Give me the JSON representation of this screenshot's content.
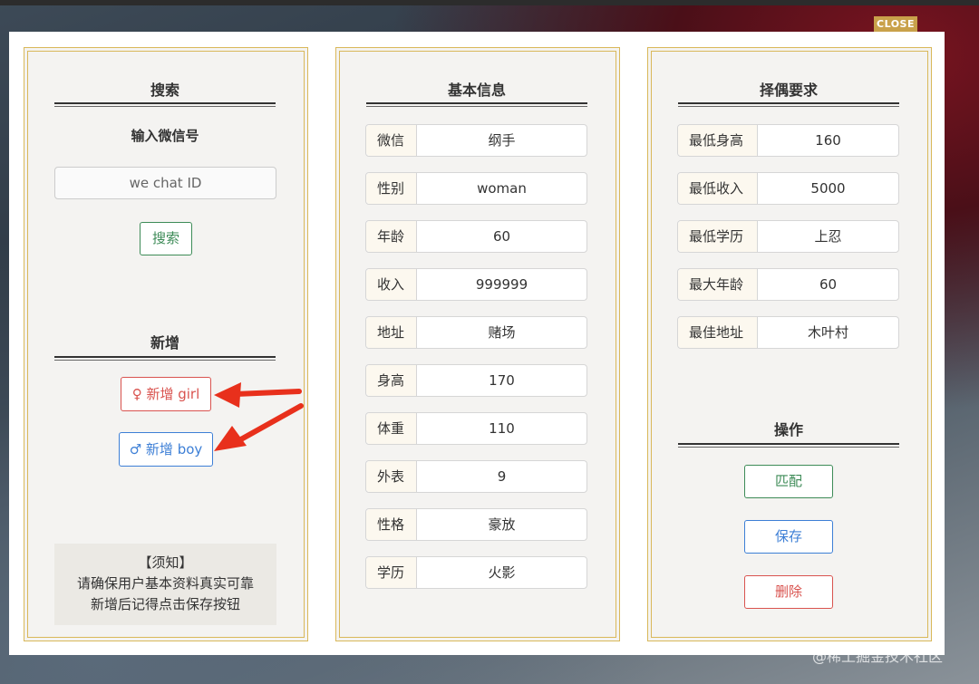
{
  "close_label": "CLOSE",
  "search_panel": {
    "title": "搜索",
    "input_label": "输入微信号",
    "input_placeholder": "we chat ID",
    "search_button": "搜索",
    "add_title": "新增",
    "add_girl_button": "♀ 新增 girl",
    "add_boy_button": "♂ 新增 boy",
    "notice_title": "【须知】",
    "notice_line1": "请确保用户基本资料真实可靠",
    "notice_line2": "新增后记得点击保存按钮"
  },
  "basic_info": {
    "title": "基本信息",
    "fields": [
      {
        "label": "微信",
        "value": "纲手"
      },
      {
        "label": "性别",
        "value": "woman"
      },
      {
        "label": "年龄",
        "value": "60"
      },
      {
        "label": "收入",
        "value": "999999"
      },
      {
        "label": "地址",
        "value": "赌场"
      },
      {
        "label": "身高",
        "value": "170"
      },
      {
        "label": "体重",
        "value": "110"
      },
      {
        "label": "外表",
        "value": "9"
      },
      {
        "label": "性格",
        "value": "豪放"
      },
      {
        "label": "学历",
        "value": "火影"
      }
    ]
  },
  "requirements": {
    "title": "择偶要求",
    "fields": [
      {
        "label": "最低身高",
        "value": "160"
      },
      {
        "label": "最低收入",
        "value": "5000"
      },
      {
        "label": "最低学历",
        "value": "上忍"
      },
      {
        "label": "最大年龄",
        "value": "60"
      },
      {
        "label": "最佳地址",
        "value": "木叶村"
      }
    ],
    "actions_title": "操作",
    "match_button": "匹配",
    "save_button": "保存",
    "delete_button": "删除"
  },
  "watermark": "@稀土掘金技术社区",
  "colors": {
    "gold": "#d9b85a",
    "green": "#3d8b57",
    "red": "#d9534f",
    "blue": "#3d7fd6",
    "arrow": "#e8301c"
  },
  "icons": [
    "female-icon",
    "male-icon",
    "arrow-icon"
  ]
}
